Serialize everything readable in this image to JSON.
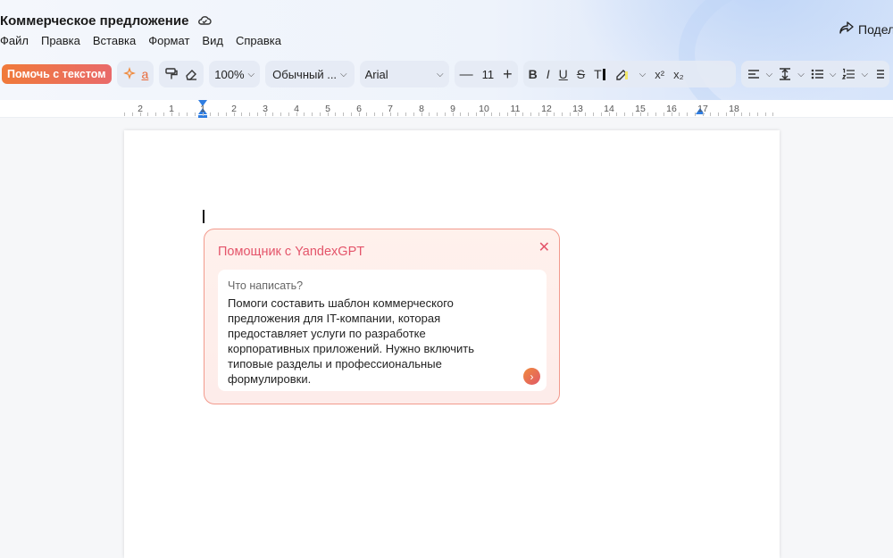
{
  "document": {
    "title": "Коммерческое предложение"
  },
  "header": {
    "share_label": "Подел"
  },
  "menu": [
    "Файл",
    "Правка",
    "Вставка",
    "Формат",
    "Вид",
    "Справка"
  ],
  "toolbar": {
    "help_text_label": "Помочь с текстом",
    "zoom": "100%",
    "style": "Обычный ...",
    "font": "Arial",
    "font_size": "11",
    "minus": "—",
    "plus": "+",
    "bold": "B",
    "italic": "I",
    "underline": "U",
    "strike": "S",
    "text_color": "T",
    "superscript": "x²",
    "subscript": "x₂"
  },
  "ruler": {
    "labels": [
      "2",
      "1",
      "1",
      "2",
      "3",
      "4",
      "5",
      "6",
      "7",
      "8",
      "9",
      "10",
      "11",
      "12",
      "13",
      "14",
      "15",
      "16",
      "17",
      "18"
    ]
  },
  "assistant": {
    "title": "Помощник с YandexGPT",
    "prompt_label": "Что написать?",
    "prompt_value": "Помоги составить шаблон коммерческого\nпредложения для IT-компании, которая\nпредоставляет услуги по разработке\nкорпоративных приложений. Нужно включить\nтиповые разделы и профессиональные\nформулировки."
  },
  "colors": {
    "accent": "#e4546a",
    "help_button": "#f07a3a",
    "ruler_marker": "#2f7de1"
  }
}
